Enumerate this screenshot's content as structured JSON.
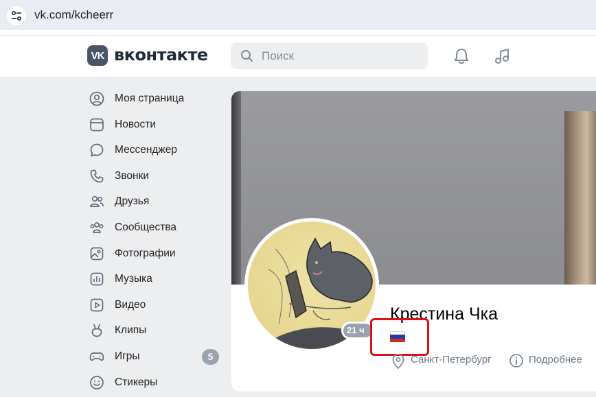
{
  "browser": {
    "url": "vk.com/kcheerr"
  },
  "header": {
    "logo_glyph": "VK",
    "logo_text": "вконтакте",
    "search_placeholder": "Поиск",
    "notifications_icon": "bell-icon",
    "music_icon": "music-icon"
  },
  "sidebar": {
    "items": [
      {
        "label": "Моя страница",
        "icon": "user-circle-icon"
      },
      {
        "label": "Новости",
        "icon": "news-icon"
      },
      {
        "label": "Мессенджер",
        "icon": "message-bubble-icon"
      },
      {
        "label": "Звонки",
        "icon": "phone-icon"
      },
      {
        "label": "Друзья",
        "icon": "friends-icon"
      },
      {
        "label": "Сообщества",
        "icon": "communities-icon"
      },
      {
        "label": "Фотографии",
        "icon": "photo-icon"
      },
      {
        "label": "Музыка",
        "icon": "music-chart-icon"
      },
      {
        "label": "Видео",
        "icon": "video-icon"
      },
      {
        "label": "Клипы",
        "icon": "clips-icon"
      },
      {
        "label": "Игры",
        "icon": "gamepad-icon",
        "badge": "5"
      },
      {
        "label": "Стикеры",
        "icon": "smile-icon"
      }
    ]
  },
  "profile": {
    "name": "Крестина Чка",
    "status_badge": "21 ч",
    "flag": "russia-flag",
    "city": "Санкт-Петербург",
    "details_link": "Подробнее"
  },
  "colors": {
    "accent": "#2688eb",
    "highlight_box": "#d8121a",
    "badge_gray": "#99a2ad"
  }
}
